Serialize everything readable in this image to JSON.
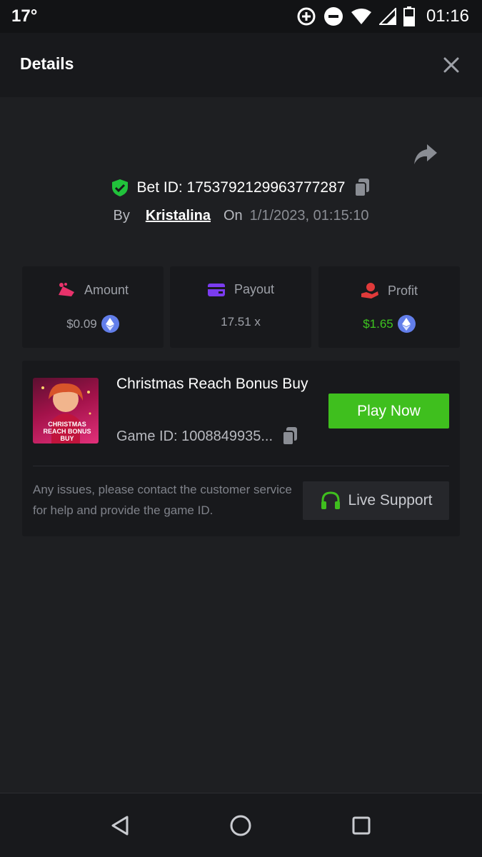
{
  "status_bar": {
    "temperature": "17°",
    "time": "01:16",
    "icons": [
      "data-saver-icon",
      "do-not-disturb-icon",
      "wifi-icon",
      "cell-signal-icon",
      "battery-icon"
    ]
  },
  "header": {
    "title": "Details",
    "close_icon": "close-icon"
  },
  "bet": {
    "id_text": "Bet ID: 1753792129963777287",
    "by_label": "By",
    "username": "Kristalina",
    "on_label": "On",
    "date": "1/1/2023, 01:15:10"
  },
  "stats": [
    {
      "label": "Amount",
      "value": "$0.09",
      "icon": "amount-icon",
      "currency_icon": "eth-icon"
    },
    {
      "label": "Payout",
      "value": "17.51 x",
      "icon": "card-icon"
    },
    {
      "label": "Profit",
      "value": "$1.65",
      "icon": "profit-hand-icon",
      "currency_icon": "eth-icon"
    }
  ],
  "game": {
    "title": "Christmas Reach Bonus Buy",
    "thumb_text": "CHRISTMAS REACH BONUS BUY",
    "game_id": "Game ID: 1008849935...",
    "play_label": "Play Now",
    "issues_text": "Any issues, please contact the customer service for help and provide the game ID.",
    "support_label": "Live Support"
  },
  "colors": {
    "accent_green": "#3fbf1e",
    "profit_green": "#3ec520",
    "shield_green": "#21c23b",
    "amount_pink": "#e8326b",
    "payout_purple": "#7b3cf0",
    "profit_red": "#e03a3a",
    "eth_blue": "#627eea"
  }
}
